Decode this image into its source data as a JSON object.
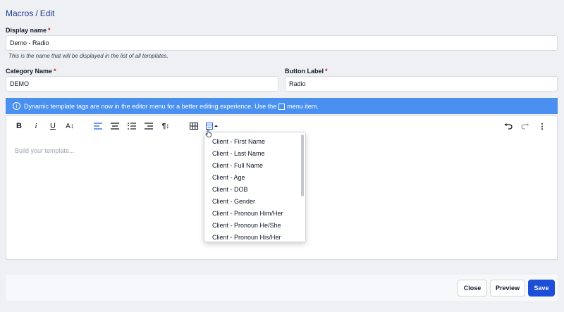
{
  "breadcrumb": {
    "parent": "Macros",
    "separator": "/",
    "current": "Edit"
  },
  "form": {
    "display_name": {
      "label": "Display name",
      "required": "*",
      "value": "Demo - Radio",
      "hint": "This is the name that will be displayed in the list of all templates."
    },
    "category_name": {
      "label": "Category Name",
      "required": "*",
      "value": "DEMO"
    },
    "button_label": {
      "label": "Button Label",
      "required": "*",
      "value": "Radio"
    }
  },
  "banner": {
    "icon": "info-icon",
    "text_before": "Dynamic template tags are now in the editor menu for a better editing experience. Use the",
    "text_after": "menu item.",
    "color": "#4a90f0"
  },
  "toolbar": {
    "bold": "B",
    "italic": "i",
    "underline": "U",
    "font_size": "A↕",
    "paragraph": "¶↕",
    "more": "⋮"
  },
  "editor": {
    "placeholder": "Build your template..."
  },
  "tags_dropdown": {
    "items": [
      "Client - First Name",
      "Client - Last Name",
      "Client - Full Name",
      "Client - Age",
      "Client - DOB",
      "Client - Gender",
      "Client - Pronoun Him/Her",
      "Client - Pronoun He/She",
      "Client - Pronoun His/Her"
    ]
  },
  "footer": {
    "close_label": "Close",
    "preview_label": "Preview",
    "save_label": "Save"
  },
  "colors": {
    "accent": "#1d4ed8",
    "banner": "#4a90f0",
    "required": "#b91c1c"
  }
}
